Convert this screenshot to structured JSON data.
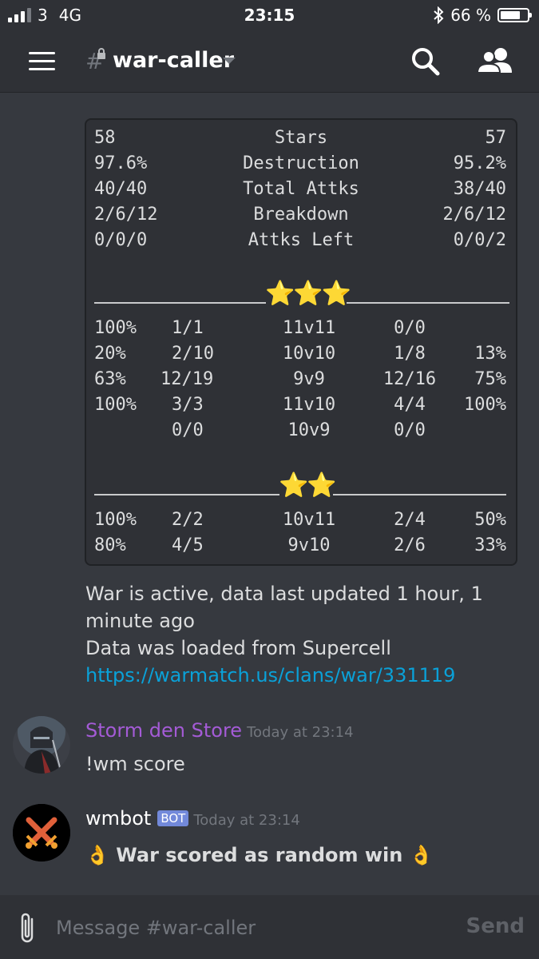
{
  "status_bar": {
    "carrier": "3",
    "network": "4G",
    "time": "23:15",
    "battery_text": "66 %",
    "battery_level": 0.66
  },
  "header": {
    "channel": "war-caller",
    "hash_symbol": "#"
  },
  "war_summary": {
    "rows": [
      {
        "left": "58",
        "label": "Stars",
        "right": "57"
      },
      {
        "left": "97.6%",
        "label": "Destruction",
        "right": "95.2%"
      },
      {
        "left": "40/40",
        "label": "Total Attks",
        "right": "38/40"
      },
      {
        "left": "2/6/12",
        "label": "Breakdown",
        "right": "2/6/12"
      },
      {
        "left": "0/0/0",
        "label": "Attks Left",
        "right": "0/0/2"
      }
    ],
    "section3_stars": "⭐⭐⭐",
    "section3_rows": [
      {
        "pct_a": "100%",
        "hits_a": "1/1",
        "matchup": "11v11",
        "hits_b": "0/0",
        "pct_b": ""
      },
      {
        "pct_a": "20%",
        "hits_a": "2/10",
        "matchup": "10v10",
        "hits_b": "1/8",
        "pct_b": "13%"
      },
      {
        "pct_a": "63%",
        "hits_a": "12/19",
        "matchup": "9v9",
        "hits_b": "12/16",
        "pct_b": "75%"
      },
      {
        "pct_a": "100%",
        "hits_a": "3/3",
        "matchup": "11v10",
        "hits_b": "4/4",
        "pct_b": "100%"
      },
      {
        "pct_a": "",
        "hits_a": "0/0",
        "matchup": "10v9",
        "hits_b": "0/0",
        "pct_b": ""
      }
    ],
    "section2_stars": "⭐⭐",
    "section2_rows": [
      {
        "pct_a": "100%",
        "hits_a": "2/2",
        "matchup": "10v11",
        "hits_b": "2/4",
        "pct_b": "50%"
      },
      {
        "pct_a": "80%",
        "hits_a": "4/5",
        "matchup": "9v10",
        "hits_b": "2/6",
        "pct_b": "33%"
      }
    ]
  },
  "bot_message": {
    "status_line": "War is active, data last updated 1 hour, 1 minute ago",
    "source_line": "Data was loaded from Supercell",
    "link": "https://warmatch.us/clans/war/331119"
  },
  "messages": [
    {
      "author": "Storm den Store",
      "author_color": "#a45bd6",
      "timestamp": "Today at 23:14",
      "text": "!wm score",
      "avatar_icon": "knight-avatar"
    },
    {
      "author": "wmbot",
      "author_color": "#ffffff",
      "badge": "BOT",
      "timestamp": "Today at 23:14",
      "text_emoji": "👌",
      "text": "War scored as random win",
      "avatar_icon": "crossed-swords-avatar"
    }
  ],
  "composer": {
    "placeholder": "Message #war-caller",
    "send_label": "Send"
  },
  "colors": {
    "background": "#36393f",
    "header": "#2f3136",
    "link": "#0aa1d8",
    "bot_badge": "#7289da"
  }
}
